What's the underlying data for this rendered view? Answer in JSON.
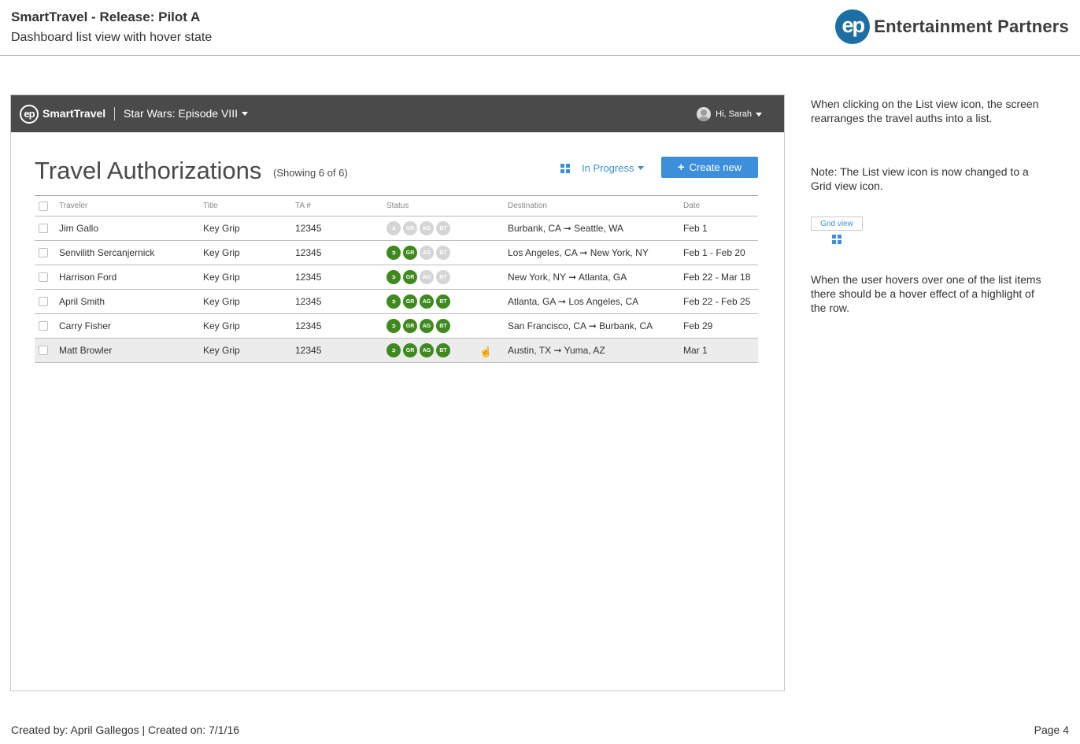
{
  "doc": {
    "title": "SmartTravel - Release: Pilot A",
    "subtitle": "Dashboard list view with hover state",
    "brand_logo": "ep",
    "brand_name": "Entertainment Partners"
  },
  "app": {
    "logo": "ep",
    "name": "SmartTravel",
    "project": "Star Wars: Episode VIII",
    "user_greeting": "Hi, Sarah"
  },
  "page": {
    "title": "Travel Authorizations",
    "count": "(Showing 6 of 6)",
    "view_icon": "grid-icon",
    "filter": "In Progress",
    "create_label": "Create new",
    "accent_color": "#3d8fdb"
  },
  "table": {
    "headers": {
      "traveler": "Traveler",
      "title": "Title",
      "ta": "TA #",
      "status": "Status",
      "destination": "Destination",
      "date": "Date"
    },
    "status_colors": {
      "complete": "#3f8a1e",
      "pending": "#d5d5d5"
    },
    "rows": [
      {
        "traveler": "Jim Gallo",
        "title": "Key Grip",
        "ta": "12345",
        "destination": "Burbank, CA ➞ Seattle, WA",
        "date": "Feb 1",
        "status": [
          false,
          false,
          false,
          false
        ]
      },
      {
        "traveler": "Senvilith Sercanjernick",
        "title": "Key Grip",
        "ta": "12345",
        "destination": "Los Angeles, CA ➞ New York, NY",
        "date": "Feb 1 - Feb 20",
        "status": [
          true,
          true,
          false,
          false
        ]
      },
      {
        "traveler": "Harrison Ford",
        "title": "Key Grip",
        "ta": "12345",
        "destination": "New York, NY ➞ Atlanta, GA",
        "date": "Feb 22 - Mar 18",
        "status": [
          true,
          true,
          false,
          false
        ]
      },
      {
        "traveler": "April Smith",
        "title": "Key Grip",
        "ta": "12345",
        "destination": "Atlanta, GA ➞ Los Angeles, CA",
        "date": "Feb 22 - Feb 25",
        "status": [
          true,
          true,
          true,
          true
        ]
      },
      {
        "traveler": "Carry Fisher",
        "title": "Key Grip",
        "ta": "12345",
        "destination": "San Francisco, CA ➞ Burbank, CA",
        "date": "Feb 29",
        "status": [
          true,
          true,
          true,
          true
        ]
      },
      {
        "traveler": "Matt Browler",
        "title": "Key Grip",
        "ta": "12345",
        "destination": "Austin, TX ➞ Yuma, AZ",
        "date": "Mar 1",
        "status": [
          true,
          true,
          true,
          true
        ],
        "hover": true
      }
    ],
    "badge_labels": [
      "➲",
      "GR",
      "AG",
      "BT"
    ]
  },
  "notes": {
    "note1": "When clicking on the List view icon, the screen rearranges the travel auths into a list.",
    "note2": "Note: The List view icon is now changed to a Grid view icon.",
    "grid_tip": "Grid view",
    "note3": "When the user hovers over one of the list items there should be a hover effect of a highlight of the row."
  },
  "footer": {
    "left": "Created by: April Gallegos | Created on: 7/1/16",
    "right": "Page 4"
  }
}
